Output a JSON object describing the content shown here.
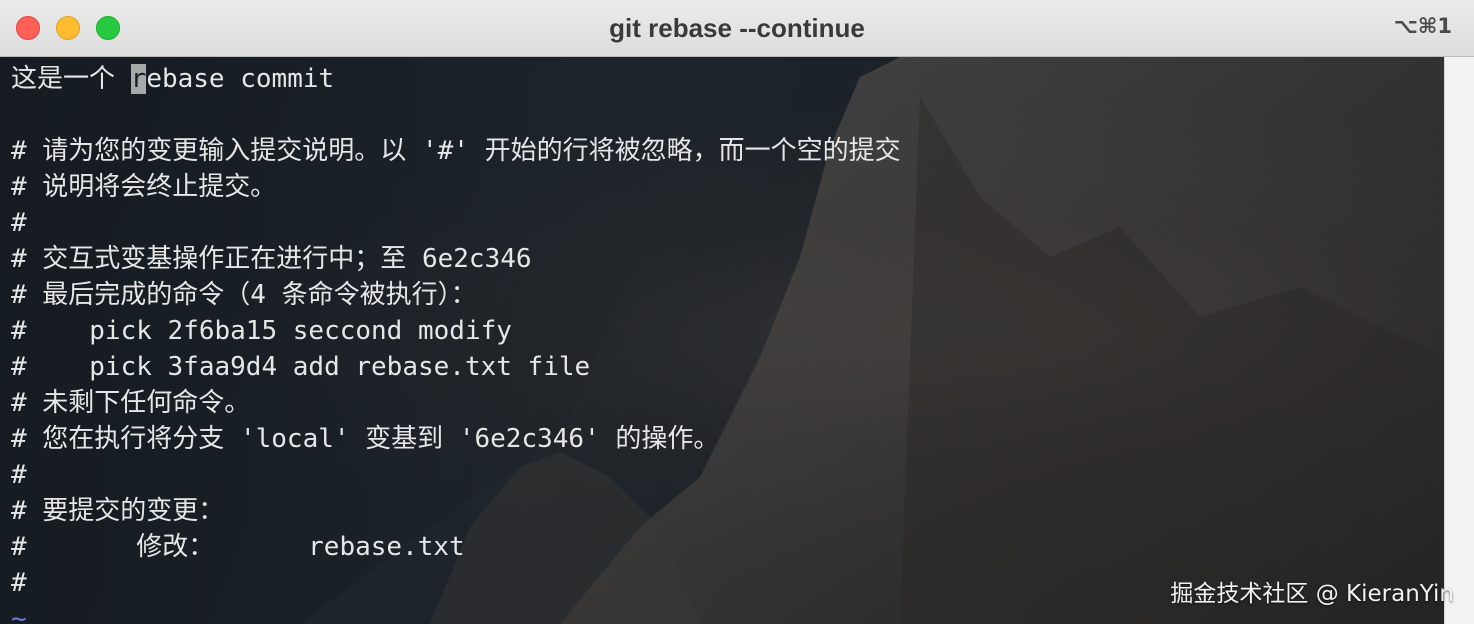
{
  "window": {
    "title": "git rebase --continue",
    "shortcut": "⌥⌘1"
  },
  "traffic_lights": {
    "close": {
      "color": "#fe5f57"
    },
    "minimize": {
      "color": "#febc2e"
    },
    "zoom": {
      "color": "#28c840"
    }
  },
  "editor": {
    "cursor_char": "r",
    "first_line_before": "这是一个 ",
    "first_line_after": "ebase commit",
    "lines": [
      "",
      "# 请为您的变更输入提交说明。以 '#' 开始的行将被忽略，而一个空的提交",
      "# 说明将会终止提交。",
      "#",
      "# 交互式变基操作正在进行中；至 6e2c346",
      "# 最后完成的命令（4 条命令被执行）：",
      "#    pick 2f6ba15 seccond modify",
      "#    pick 3faa9d4 add rebase.txt file",
      "# 未剩下任何命令。",
      "# 您在执行将分支 'local' 变基到 '6e2c346' 的操作。",
      "#",
      "# 要提交的变更：",
      "#       修改：      rebase.txt",
      "#"
    ],
    "tilde": "~",
    "text_color": "#e6e6e6",
    "tilde_color": "#6f7ad8"
  },
  "watermark": "掘金技术社区 @ KieranYin"
}
